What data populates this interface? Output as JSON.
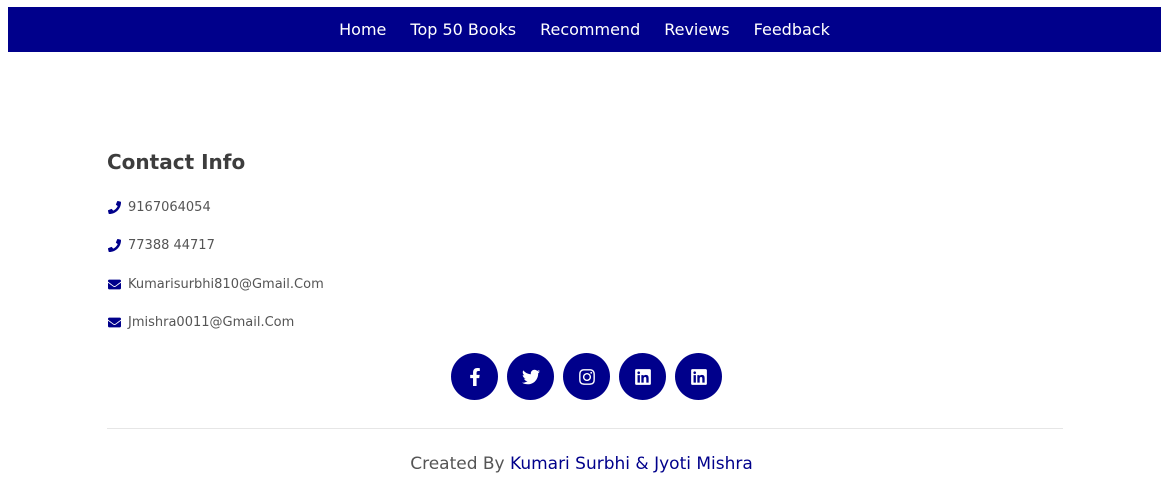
{
  "nav": {
    "items": [
      {
        "label": "Home"
      },
      {
        "label": "Top 50 Books"
      },
      {
        "label": "Recommend"
      },
      {
        "label": "Reviews"
      },
      {
        "label": "Feedback"
      }
    ]
  },
  "contact": {
    "title": "Contact Info",
    "items": [
      {
        "icon": "phone-icon",
        "text": "9167064054"
      },
      {
        "icon": "phone-icon",
        "text": "77388 44717"
      },
      {
        "icon": "envelope-icon",
        "text": "Kumarisurbhi810@Gmail.Com"
      },
      {
        "icon": "envelope-icon",
        "text": "Jmishra0011@Gmail.Com"
      }
    ]
  },
  "social": {
    "items": [
      {
        "icon": "facebook-icon"
      },
      {
        "icon": "twitter-icon"
      },
      {
        "icon": "instagram-icon"
      },
      {
        "icon": "linkedin-icon"
      },
      {
        "icon": "linkedin-icon"
      }
    ]
  },
  "footer": {
    "prefix": "Created By ",
    "authors": "Kumari Surbhi & Jyoti Mishra"
  },
  "colors": {
    "brand": "#00008b",
    "text": "#555555",
    "heading": "#3d3d3d",
    "divider": "#e6e6e6"
  }
}
